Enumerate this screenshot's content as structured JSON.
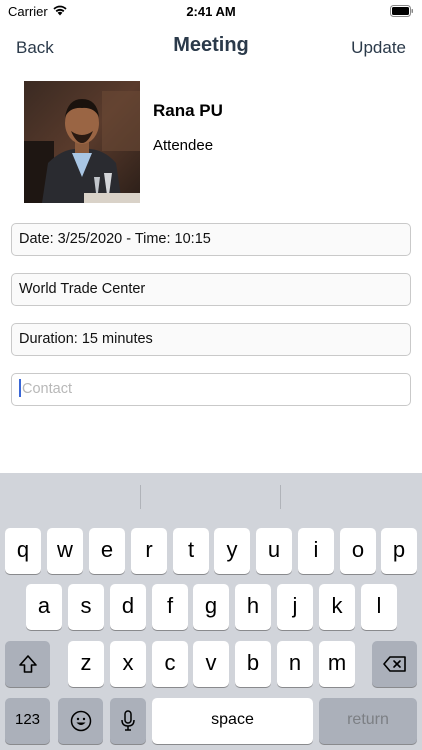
{
  "status_bar": {
    "carrier": "Carrier",
    "time": "2:41 AM"
  },
  "nav": {
    "back_label": "Back",
    "title": "Meeting",
    "update_label": "Update"
  },
  "attendee": {
    "name": "Rana PU",
    "role": "Attendee"
  },
  "fields": {
    "datetime": "Date: 3/25/2020 - Time: 10:15",
    "location": "World Trade Center",
    "duration": "Duration: 15 minutes",
    "contact_placeholder": "Contact"
  },
  "keyboard": {
    "row1": [
      "q",
      "w",
      "e",
      "r",
      "t",
      "y",
      "u",
      "i",
      "o",
      "p"
    ],
    "row2": [
      "a",
      "s",
      "d",
      "f",
      "g",
      "h",
      "j",
      "k",
      "l"
    ],
    "row3": [
      "z",
      "x",
      "c",
      "v",
      "b",
      "n",
      "m"
    ],
    "numbers_label": "123",
    "space_label": "space",
    "return_label": "return"
  }
}
